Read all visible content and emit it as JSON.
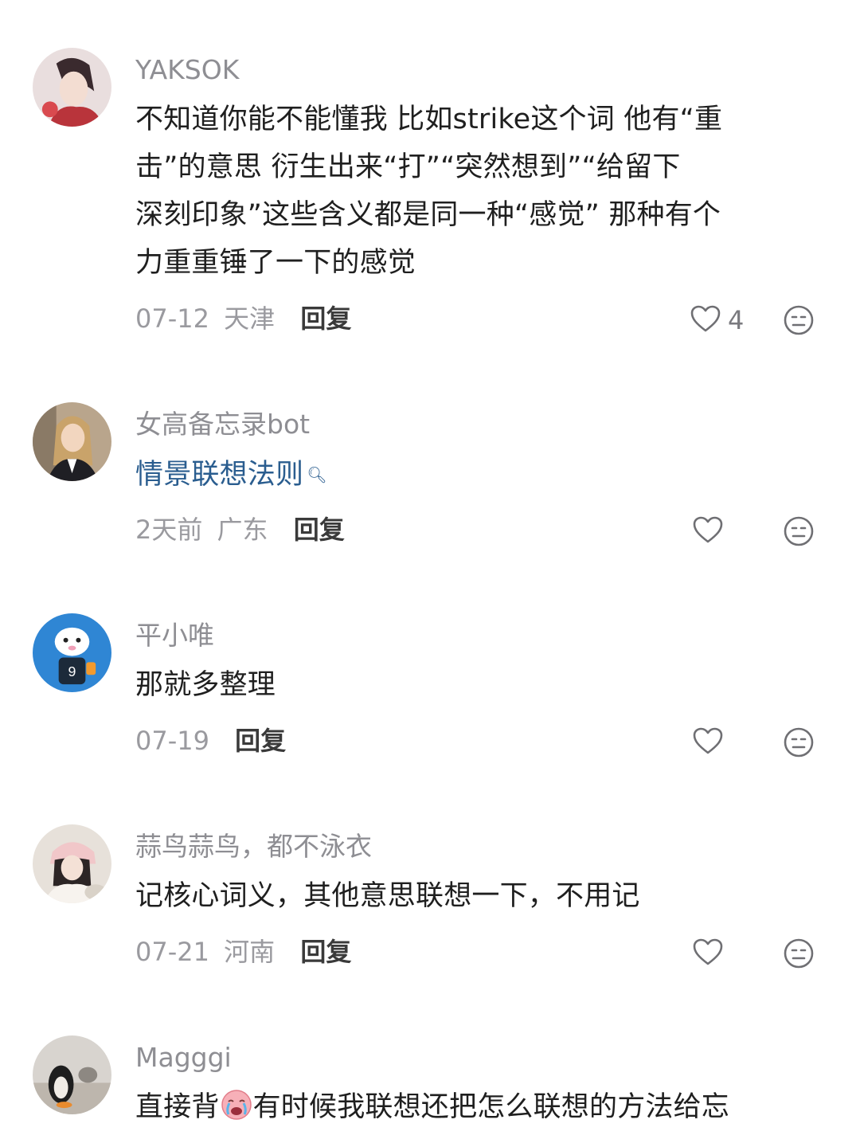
{
  "comments": [
    {
      "username": "YAKSOK",
      "text_lines": [
        "不知道你能不能懂我 比如strike这个词 他有“重",
        "击”的意思 衍生出来“打”“突然想到”“给留下",
        "深刻印象”这些含义都是同一种“感觉” 那种有个",
        "力重重锤了一下的感觉"
      ],
      "date": "07-12",
      "location": "天津",
      "reply_label": "回复",
      "likes": "4"
    },
    {
      "username": "女高备忘录bot",
      "text_lines": [
        "情景联想法则"
      ],
      "date": "2天前",
      "location": "广东",
      "reply_label": "回复",
      "likes": ""
    },
    {
      "username": "平小唯",
      "text_lines": [
        "那就多整理"
      ],
      "date": "07-19",
      "location": "",
      "reply_label": "回复",
      "likes": ""
    },
    {
      "username": "蒜鸟蒜鸟，都不泳衣",
      "text_lines": [
        "记核心词义，其他意思联想一下，不用记"
      ],
      "date": "07-21",
      "location": "河南",
      "reply_label": "回复",
      "likes": ""
    },
    {
      "username": "Magggi",
      "text_before_emoji": "直接背",
      "text_after_emoji": "有时候我联想还把怎么联想的方法给忘",
      "emoji_name": "crying-face-emoji"
    }
  ],
  "icons": {
    "like": "heart-outline-icon",
    "react": "emoji-face-icon",
    "search": "search-icon"
  },
  "colors": {
    "username": "#8e8e93",
    "body_text": "#1f1f1f",
    "link_text": "#2a5d8f",
    "meta_text": "#9a9a9f"
  }
}
